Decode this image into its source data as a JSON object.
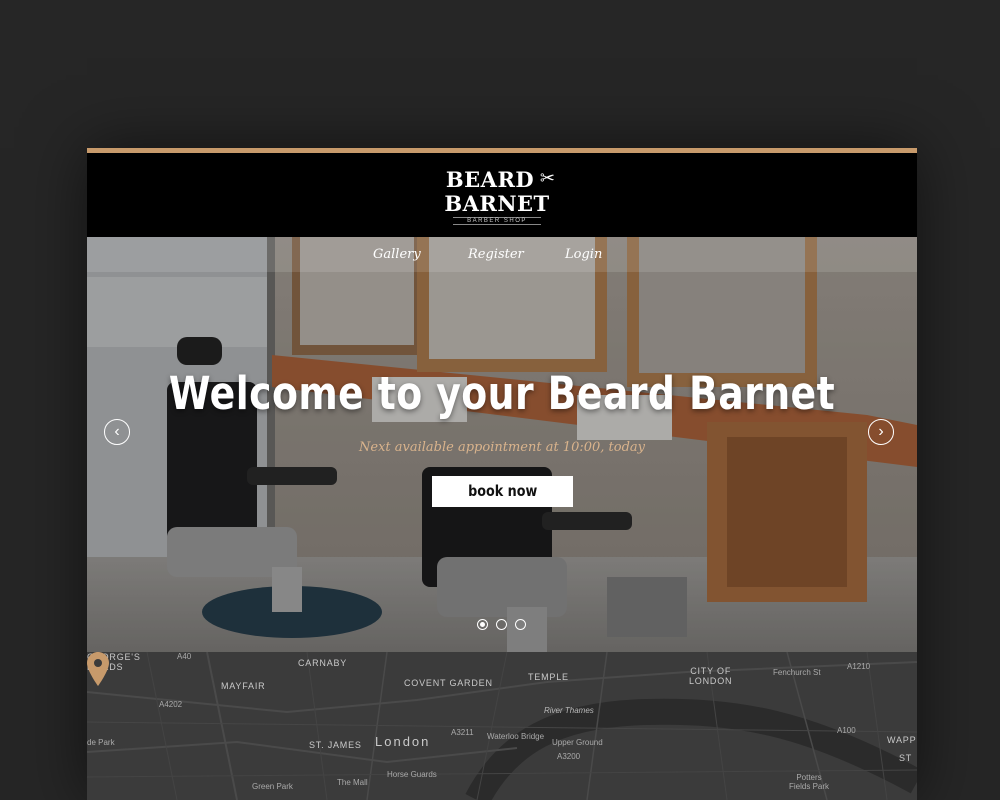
{
  "colors": {
    "accent": "#c79a6b",
    "subtitle": "#d9b38c",
    "page_bg": "#262626"
  },
  "brand": {
    "line1": "BEARD",
    "line2": "BARNET",
    "tagline": "BARBER SHOP",
    "icon": "scissors-icon"
  },
  "nav": {
    "items": [
      {
        "label": "Gallery"
      },
      {
        "label": "Register"
      },
      {
        "label": "Login"
      }
    ]
  },
  "hero": {
    "title": "Welcome to your Beard Barnet",
    "subtitle": "Next available appointment at 10:00, today",
    "cta_label": "book now",
    "prev_icon": "chevron-left-icon",
    "next_icon": "chevron-right-icon",
    "slides": 3,
    "active_slide": 1
  },
  "map": {
    "labels": {
      "st_georges_fields": "GEORGE'S\nFIELDS",
      "carnaby": "CARNABY",
      "mayfair": "MAYFAIR",
      "covent_garden": "COVENT GARDEN",
      "temple": "TEMPLE",
      "city_of_london": "CITY OF\nLONDON",
      "london": "London",
      "st_james": "ST. JAMES",
      "river_thames": "River Thames",
      "green_park": "Green Park",
      "potters_fields": "Potters\nFields Park",
      "hyde_park": "de Park",
      "wapping": "WAPP",
      "st": "ST",
      "a3211": "A3211",
      "a3200": "A3200",
      "a100": "A100",
      "a4202": "A4202",
      "a1210": "A1210",
      "a40": "A40",
      "the_mall": "The Mall",
      "fenchurch": "Fenchurch St",
      "waterloo": "Waterloo Bridge",
      "upper_ground": "Upper Ground",
      "horse_guards": "Horse Guards"
    },
    "pin_icon": "map-pin-icon"
  }
}
